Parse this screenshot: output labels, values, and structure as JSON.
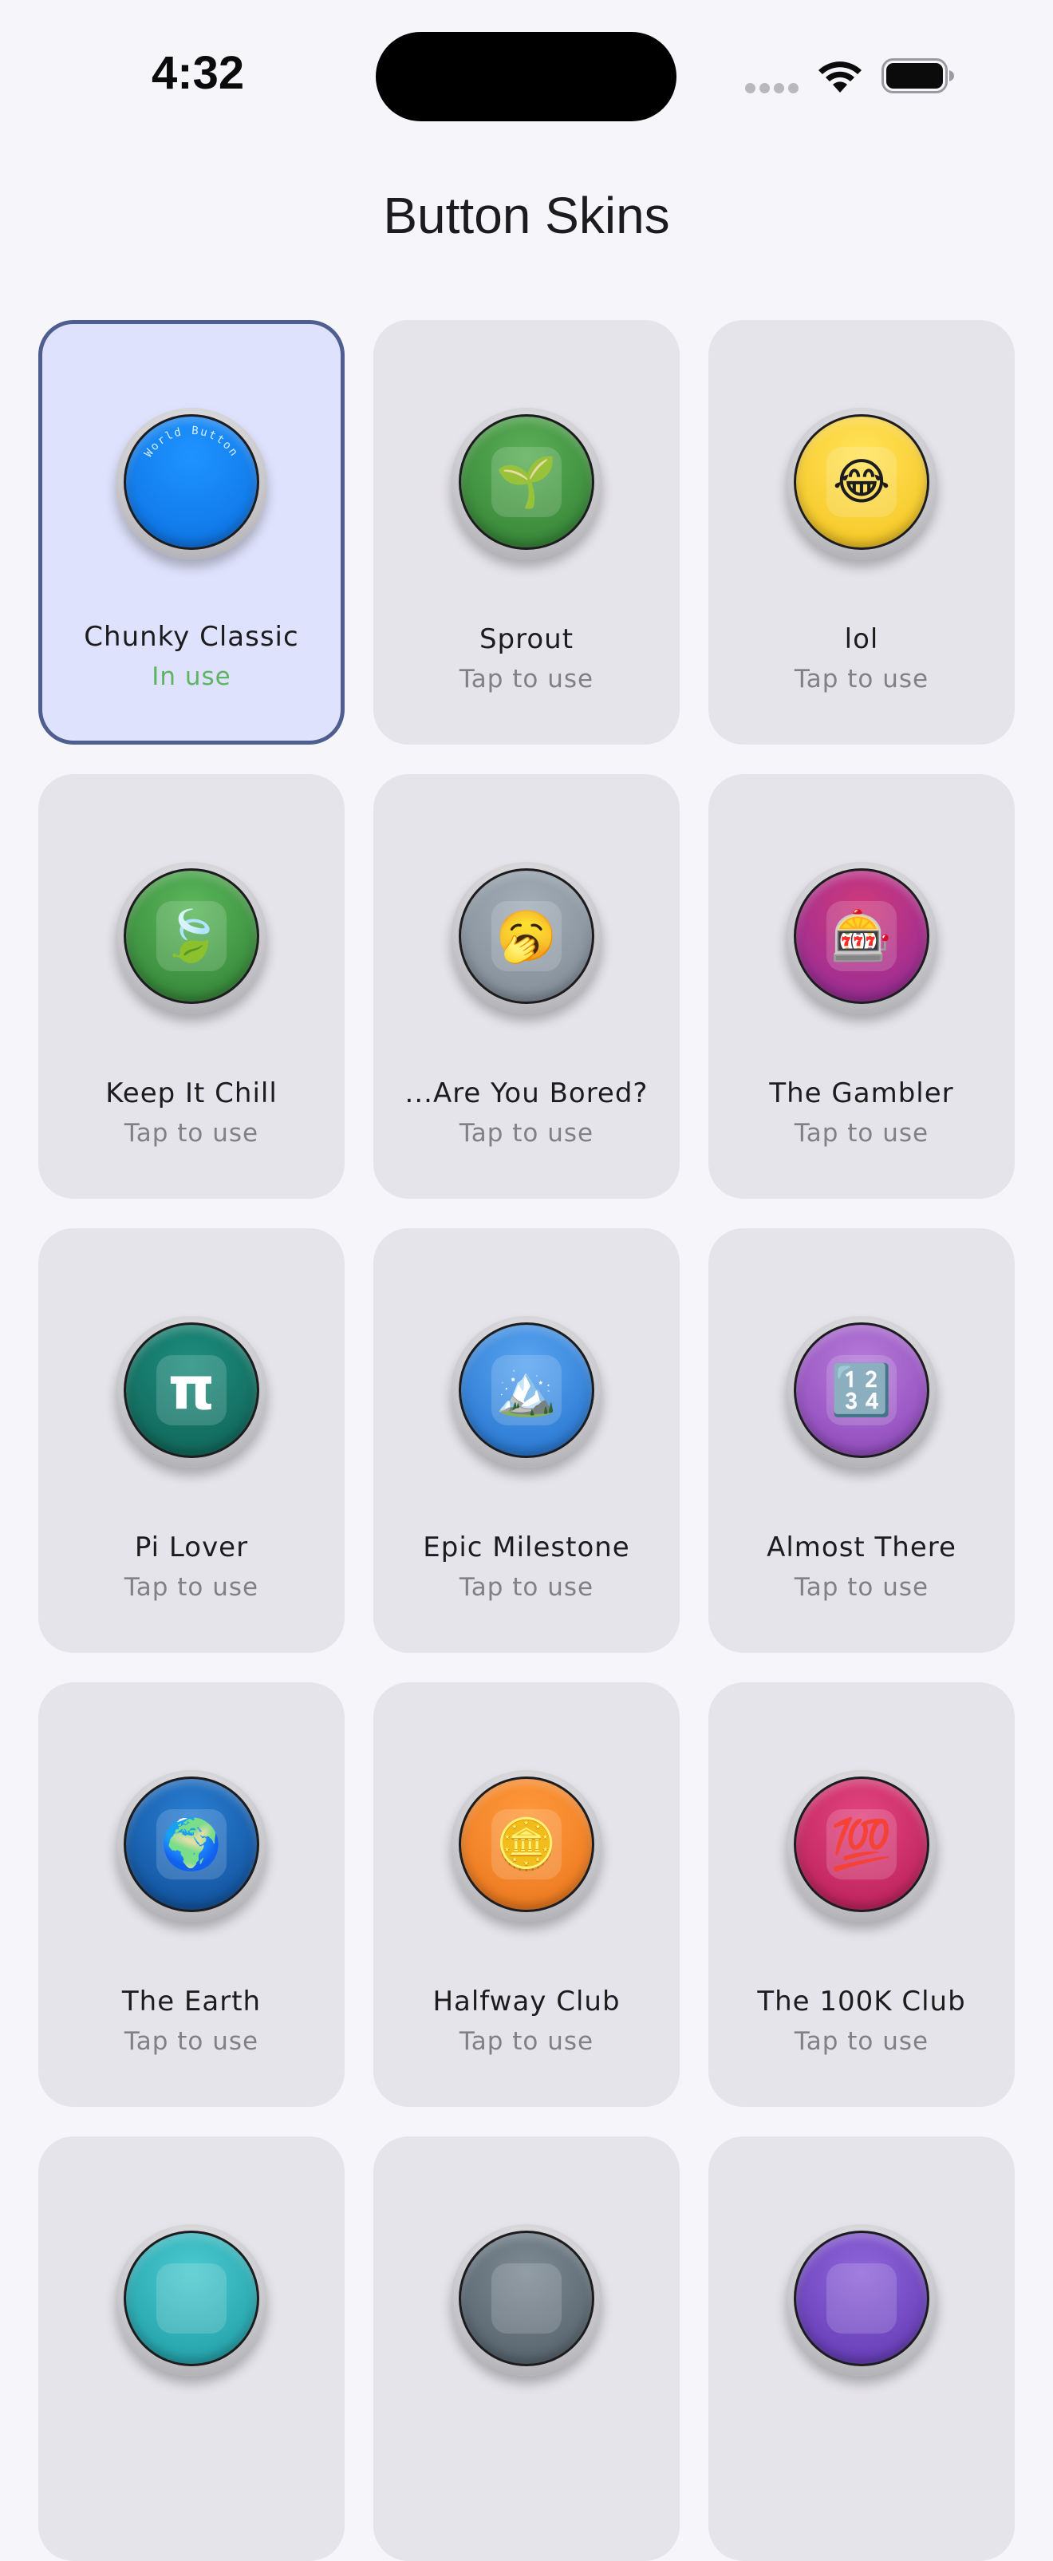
{
  "status_bar": {
    "time": "4:32"
  },
  "page": {
    "title": "Button Skins"
  },
  "skins": [
    {
      "name": "Chunky Classic",
      "status": "In use",
      "selected": true,
      "color_top": "#1E94FF",
      "color_bottom": "#0C6FE0",
      "icon": "world-button-text",
      "glyph": "",
      "arc_text": "World Button"
    },
    {
      "name": "Sprout",
      "status": "Tap to use",
      "selected": false,
      "color_top": "#5CAF57",
      "color_bottom": "#2F7E32",
      "icon": "seedling-icon",
      "glyph": "🌱"
    },
    {
      "name": "lol",
      "status": "Tap to use",
      "selected": false,
      "color_top": "#FFE35A",
      "color_bottom": "#F4C21B",
      "icon": "laughing-face-icon",
      "glyph": "😂"
    },
    {
      "name": "Keep It Chill",
      "status": "Tap to use",
      "selected": false,
      "color_top": "#5CB85C",
      "color_bottom": "#2E7D32",
      "icon": "leaf-icon",
      "glyph": "🍃"
    },
    {
      "name": "...Are You Bored?",
      "status": "Tap to use",
      "selected": false,
      "color_top": "#A3AEB8",
      "color_bottom": "#7D8893",
      "icon": "yawning-face-icon",
      "glyph": "🥱"
    },
    {
      "name": "The Gambler",
      "status": "Tap to use",
      "selected": false,
      "color_top": "#D13A7A",
      "color_bottom": "#8C2A9B",
      "icon": "slot-machine-icon",
      "glyph": "🎰"
    },
    {
      "name": "Pi Lover",
      "status": "Tap to use",
      "selected": false,
      "color_top": "#1E8E7E",
      "color_bottom": "#0E5F53",
      "icon": "pi-icon",
      "glyph": "π"
    },
    {
      "name": "Epic Milestone",
      "status": "Tap to use",
      "selected": false,
      "color_top": "#5AA5F0",
      "color_bottom": "#1F6FCC",
      "icon": "mountain-icon",
      "glyph": "🏔️"
    },
    {
      "name": "Almost There",
      "status": "Tap to use",
      "selected": false,
      "color_top": "#B57BD8",
      "color_bottom": "#8A43B8",
      "icon": "numbers-icon",
      "glyph": "🔢"
    },
    {
      "name": "The Earth",
      "status": "Tap to use",
      "selected": false,
      "color_top": "#2A7FD4",
      "color_bottom": "#0D4A92",
      "icon": "globe-icon",
      "glyph": "🌍"
    },
    {
      "name": "Halfway Club",
      "status": "Tap to use",
      "selected": false,
      "color_top": "#FF9A3C",
      "color_bottom": "#E9731A",
      "icon": "coin-icon",
      "glyph": "🪙"
    },
    {
      "name": "The 100K Club",
      "status": "Tap to use",
      "selected": false,
      "color_top": "#E2457E",
      "color_bottom": "#B71C57",
      "icon": "hundred-points-icon",
      "glyph": "💯"
    },
    {
      "name": "",
      "status": "",
      "selected": false,
      "color_top": "#4BC9CF",
      "color_bottom": "#1C9AA3",
      "icon": "partial-icon",
      "glyph": ""
    },
    {
      "name": "",
      "status": "",
      "selected": false,
      "color_top": "#7D8A94",
      "color_bottom": "#505C66",
      "icon": "partial-icon",
      "glyph": ""
    },
    {
      "name": "",
      "status": "",
      "selected": false,
      "color_top": "#8F66D9",
      "color_bottom": "#5E35B1",
      "icon": "partial-icon",
      "glyph": ""
    }
  ]
}
